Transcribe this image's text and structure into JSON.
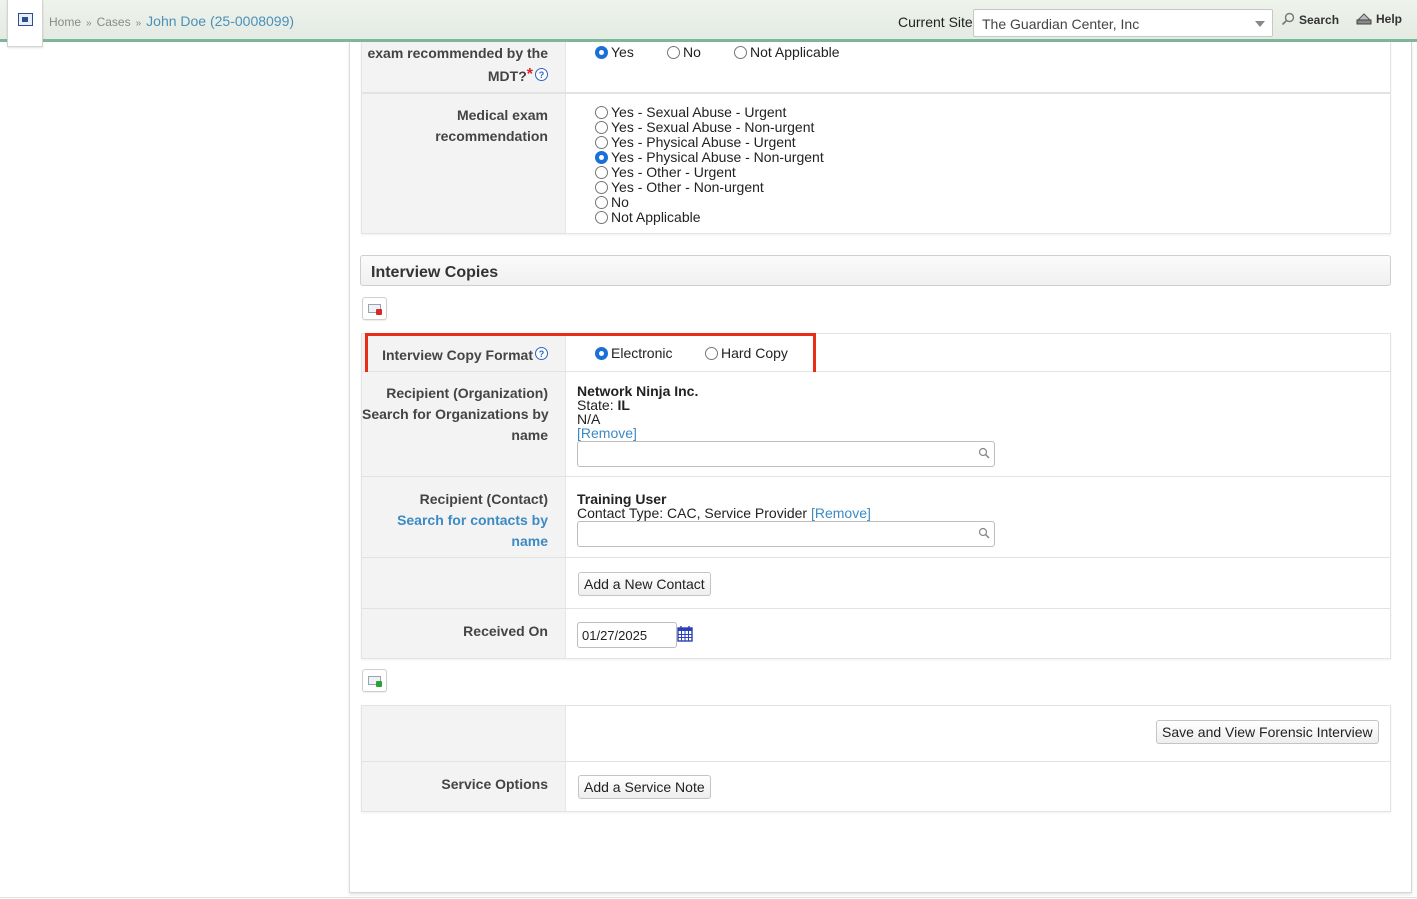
{
  "header": {
    "breadcrumbs": [
      "Home",
      "Cases",
      "John Doe (25-0008099)"
    ],
    "current_site_label": "Current Site",
    "current_site_value": "The Guardian Center, Inc",
    "search_label": "Search",
    "help_label": "Help"
  },
  "exam_recommended": {
    "label_line1": "exam recommended by the",
    "label_line2": "MDT?",
    "required_mark": "*",
    "help_glyph": "?",
    "options": [
      "Yes",
      "No",
      "Not Applicable"
    ],
    "selected": "Yes"
  },
  "medical_exam": {
    "label_line1": "Medical exam",
    "label_line2": "recommendation",
    "options": [
      "Yes - Sexual Abuse - Urgent",
      "Yes - Sexual Abuse - Non-urgent",
      "Yes - Physical Abuse - Urgent",
      "Yes - Physical Abuse - Non-urgent",
      "Yes - Other - Urgent",
      "Yes - Other - Non-urgent",
      "No",
      "Not Applicable"
    ],
    "selected": "Yes - Physical Abuse - Non-urgent"
  },
  "interview_copies": {
    "section_title": "Interview Copies",
    "format": {
      "label": "Interview Copy Format",
      "help_glyph": "?",
      "options": [
        "Electronic",
        "Hard Copy"
      ],
      "selected": "Electronic"
    },
    "recipient_org": {
      "label_line1": "Recipient (Organization)",
      "label_line2": "Search for Organizations by",
      "label_line3": "name",
      "name": "Network Ninja Inc.",
      "state_label": "State:",
      "state_value": "IL",
      "extra": "N/A",
      "remove_link": "[Remove]",
      "search_value": ""
    },
    "recipient_contact": {
      "label_line1": "Recipient (Contact)",
      "label_line2": "Search for contacts by",
      "label_line3": "name",
      "name": "Training User",
      "contact_type": "Contact Type: CAC, Service Provider",
      "remove_link": "[Remove]",
      "search_value": ""
    },
    "add_contact_button": "Add a New Contact",
    "received_on_label": "Received On",
    "received_on_value": "01/27/2025"
  },
  "actions": {
    "save_button": "Save and View Forensic Interview",
    "service_options_label": "Service Options",
    "add_service_note_button": "Add a Service Note"
  },
  "colors": {
    "header_accent": "#7fb59a",
    "highlight": "#e82c16",
    "link": "#3c8ac4",
    "radio_selected": "#1a6fd8"
  }
}
